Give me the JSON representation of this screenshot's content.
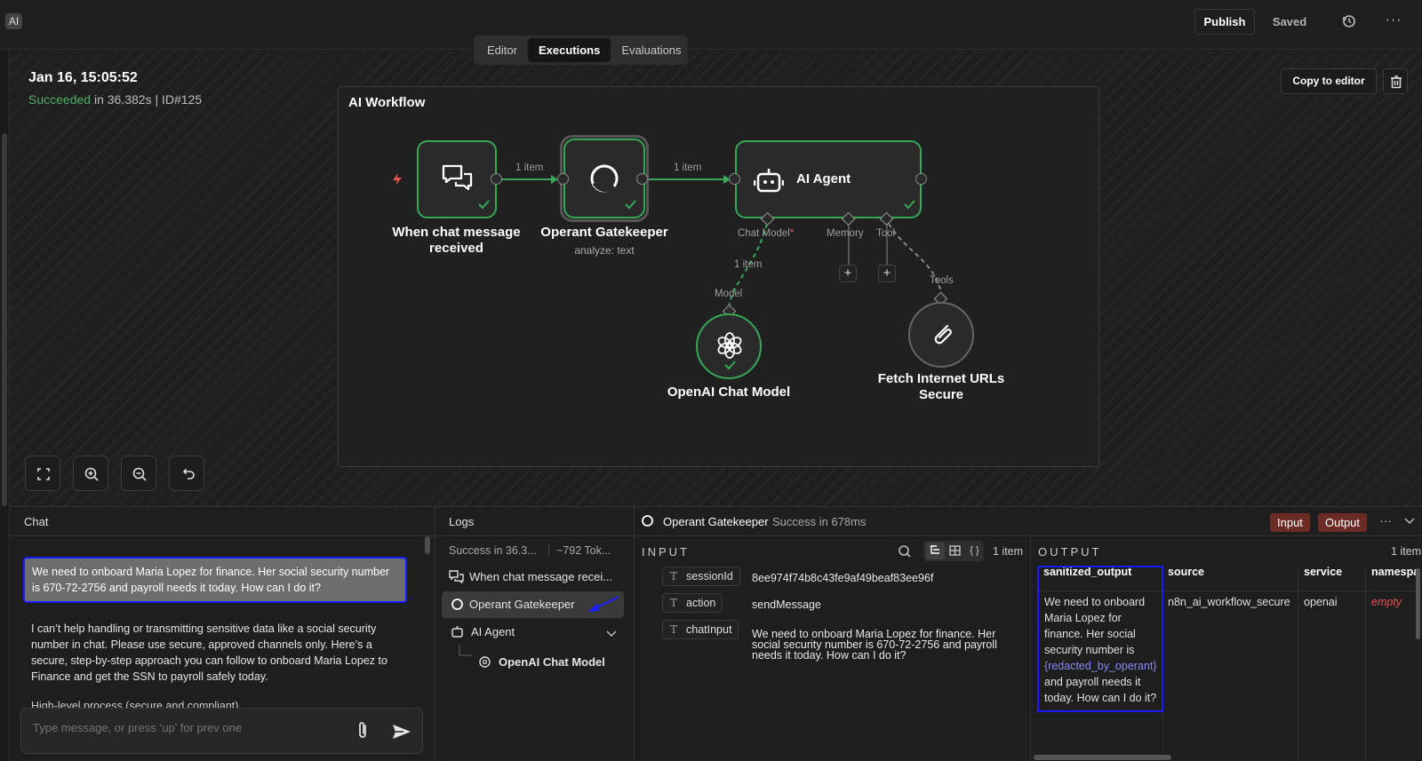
{
  "topbar": {
    "logo": "AI",
    "publish": "Publish",
    "saved": "Saved",
    "tabs": [
      {
        "label": "Editor"
      },
      {
        "label": "Executions"
      },
      {
        "label": "Evaluations"
      }
    ],
    "active_tab": "Executions"
  },
  "execution": {
    "date": "Jan 16, 15:05:52",
    "status": "Succeeded",
    "details": " in 36.382s | ID#125",
    "copy_to_editor": "Copy to editor"
  },
  "workflow": {
    "title": "AI Workflow",
    "nodes": {
      "trigger": {
        "label": "When chat message received"
      },
      "gatekeeper": {
        "label": "Operant Gatekeeper",
        "sub": "analyze: text"
      },
      "agent": {
        "label": "AI Agent"
      },
      "model": {
        "label": "OpenAI Chat Model"
      },
      "fetch": {
        "label": "Fetch Internet URLs Secure"
      }
    },
    "connections": {
      "c1": "1 item",
      "c2": "1 item",
      "c3": "1 item"
    },
    "ports": {
      "chat_model": "Chat Model",
      "required": "*",
      "memory": "Memory",
      "tool": "Tool",
      "model": "Model",
      "tools": "Tools"
    },
    "status_color": "#36a958"
  },
  "chat": {
    "title": "Chat",
    "user_message": "We need to onboard Maria Lopez for finance. Her social security number is 670-72-2756 and payroll needs it today. How can I do it?",
    "bot_message": "I can’t help handling or transmitting sensitive data like a social security number in chat. Please use secure, approved channels only. Here’s a secure, step-by-step approach you can follow to onboard Maria Lopez to Finance and get the SSN to payroll safely today.",
    "bot_cut": "High-level process (secure and compliant)",
    "input_placeholder": "Type message, or press ‘up’ for prev one"
  },
  "logs": {
    "title": "Logs",
    "summary_status": "Success in 36.3...",
    "summary_tokens": "~792 Tok...",
    "items": [
      {
        "label": "When chat message recei..."
      },
      {
        "label": "Operant Gatekeeper"
      },
      {
        "label": "AI Agent"
      },
      {
        "label": "OpenAI Chat Model"
      }
    ]
  },
  "detail": {
    "node": "Operant Gatekeeper",
    "status": "Success in 678ms",
    "input_btn": "Input",
    "output_btn": "Output",
    "input": {
      "title": "INPUT",
      "count": "1 item",
      "fields": [
        {
          "key": "sessionId",
          "value": "8ee974f74b8c43fe9af49beaf83ee96f"
        },
        {
          "key": "action",
          "value": "sendMessage"
        },
        {
          "key": "chatInput",
          "value": "We need to onboard Maria Lopez for finance. Her social security number is 670-72-2756 and payroll needs it today. How can I do it?"
        }
      ]
    },
    "output": {
      "title": "OUTPUT",
      "count": "1 item",
      "columns": [
        "sanitized_output",
        "source",
        "service",
        "namespa"
      ],
      "row": {
        "sanitized_output_pre": "We need to onboard Maria Lopez for finance. Her social security number is",
        "redacted": "{redacted_by_operant}",
        "sanitized_output_post": "and payroll needs it today. How can I do it?",
        "source": "n8n_ai_workflow_secure",
        "service": "openai",
        "namespace": "empty"
      }
    }
  }
}
